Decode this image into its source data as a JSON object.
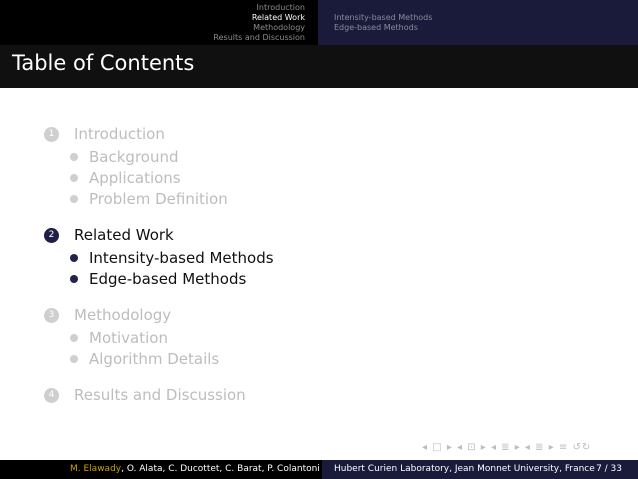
{
  "header": {
    "sections": [
      "Introduction",
      "Related Work",
      "Methodology",
      "Results and Discussion"
    ],
    "active_index": 1,
    "subsections": [
      "Intensity-based Methods",
      "Edge-based Methods"
    ]
  },
  "title": "Table of Contents",
  "toc": [
    {
      "num": "1",
      "label": "Introduction",
      "state": "dim",
      "subs": [
        "Background",
        "Applications",
        "Problem Definition"
      ]
    },
    {
      "num": "2",
      "label": "Related Work",
      "state": "act",
      "subs": [
        "Intensity-based Methods",
        "Edge-based Methods"
      ]
    },
    {
      "num": "3",
      "label": "Methodology",
      "state": "dim",
      "subs": [
        "Motivation",
        "Algorithm Details"
      ]
    },
    {
      "num": "4",
      "label": "Results and Discussion",
      "state": "dim",
      "subs": []
    }
  ],
  "nav_symbols": "◂ □ ▸ ◂ ⊡ ▸ ◂ ≣ ▸ ◂ ≣ ▸ ≡ ↺↻",
  "footer": {
    "author_highlight": "M. Elawady",
    "authors_rest": ", O. Alata, C. Ducottet, C. Barat, P. Colantoni",
    "institution": "Hubert Curien Laboratory, Jean Monnet University, France",
    "page": "7 / 33"
  }
}
